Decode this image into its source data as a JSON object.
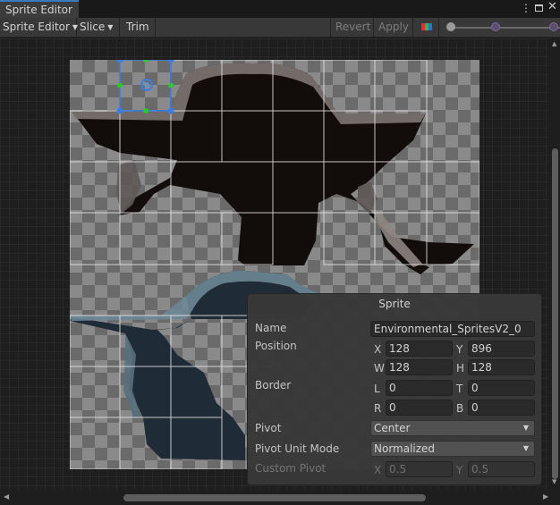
{
  "window": {
    "tab_title": "Sprite Editor"
  },
  "toolbar": {
    "mode_label": "Sprite Editor",
    "slice_label": "Slice",
    "trim_label": "Trim",
    "revert_label": "Revert",
    "apply_label": "Apply"
  },
  "panel": {
    "title": "Sprite",
    "name_label": "Name",
    "name_value": "Environmental_SpritesV2_0",
    "position_label": "Position",
    "x_label": "X",
    "x_value": "128",
    "y_label": "Y",
    "y_value": "896",
    "w_label": "W",
    "w_value": "128",
    "h_label": "H",
    "h_value": "128",
    "border_label": "Border",
    "l_label": "L",
    "l_value": "0",
    "t_label": "T",
    "t_value": "0",
    "r_label": "R",
    "r_value": "0",
    "b_label": "B",
    "b_value": "0",
    "pivot_label": "Pivot",
    "pivot_value": "Center",
    "pivot_unit_label": "Pivot Unit Mode",
    "pivot_unit_value": "Normalized",
    "custom_pivot_label": "Custom Pivot",
    "cx_label": "X",
    "cx_value": "0.5",
    "cy_label": "Y",
    "cy_value": "0.5"
  },
  "colors": {
    "selection": "#3b7de0",
    "handle": "#22d022",
    "cave_dark": "#120c0a",
    "cave_blue": "#1f2b36",
    "rock": "#7e7672",
    "rock_blue": "#6d8796"
  }
}
